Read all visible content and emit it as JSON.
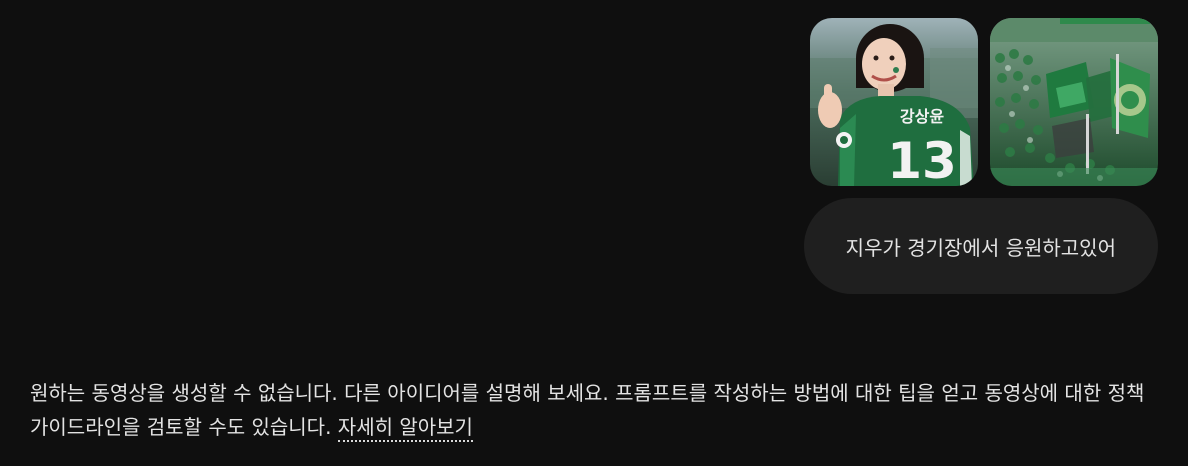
{
  "attachments": [
    {
      "icon": "image-player-jersey",
      "jersey_name": "강상윤",
      "jersey_number": "13"
    },
    {
      "icon": "image-stadium-crowd"
    }
  ],
  "user_message": "지우가 경기장에서 응원하고있어",
  "assistant_reply": {
    "text": "원하는 동영상을 생성할 수 없습니다. 다른 아이디어를 설명해 보세요. 프롬프트를 작성하는 방법에 대한 팁을 얻고 동영상에 대한 정책 가이드라인을 검토할 수도 있습니다. ",
    "link_label": "자세히 알아보기"
  },
  "colors": {
    "background": "#0f0f0f",
    "bubble": "#1f1f1f",
    "text": "#e3e3e3",
    "jersey_green": "#1f6e3f"
  }
}
